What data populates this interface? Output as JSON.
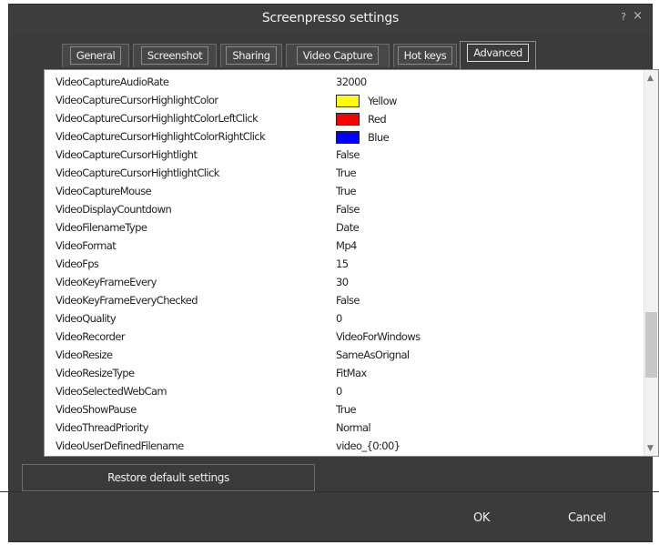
{
  "window": {
    "title": "Screenpresso settings",
    "help": "?",
    "close": "×"
  },
  "tabs": [
    {
      "label": "General"
    },
    {
      "label": "Screenshot"
    },
    {
      "label": "Sharing"
    },
    {
      "label": "Video Capture"
    },
    {
      "label": "Hot keys"
    },
    {
      "label": "Advanced",
      "active": true
    }
  ],
  "properties": [
    {
      "name": "VideoCaptureAudioRate",
      "value": "32000"
    },
    {
      "name": "VideoCaptureCursorHighlightColor",
      "value": "Yellow",
      "color": "#ffff00"
    },
    {
      "name": "VideoCaptureCursorHighlightColorLeftClick",
      "value": "Red",
      "color": "#ff0000"
    },
    {
      "name": "VideoCaptureCursorHighlightColorRightClick",
      "value": "Blue",
      "color": "#0000ff"
    },
    {
      "name": "VideoCaptureCursorHightlight",
      "value": "False"
    },
    {
      "name": "VideoCaptureCursorHightlightClick",
      "value": "True"
    },
    {
      "name": "VideoCaptureMouse",
      "value": "True"
    },
    {
      "name": "VideoDisplayCountdown",
      "value": "False"
    },
    {
      "name": "VideoFilenameType",
      "value": "Date"
    },
    {
      "name": "VideoFormat",
      "value": "Mp4"
    },
    {
      "name": "VideoFps",
      "value": "15"
    },
    {
      "name": "VideoKeyFrameEvery",
      "value": "30"
    },
    {
      "name": "VideoKeyFrameEveryChecked",
      "value": "False"
    },
    {
      "name": "VideoQuality",
      "value": "0"
    },
    {
      "name": "VideoRecorder",
      "value": "VideoForWindows"
    },
    {
      "name": "VideoResize",
      "value": "SameAsOrignal"
    },
    {
      "name": "VideoResizeType",
      "value": "FitMax"
    },
    {
      "name": "VideoSelectedWebCam",
      "value": "0"
    },
    {
      "name": "VideoShowPause",
      "value": "True"
    },
    {
      "name": "VideoThreadPriority",
      "value": "Normal"
    },
    {
      "name": "VideoUserDefinedFilename",
      "value": "video_{0:00}"
    }
  ],
  "buttons": {
    "restore": "Restore default settings",
    "ok": "OK",
    "cancel": "Cancel"
  },
  "scrollbar": {
    "up": "▲",
    "down": "▼"
  }
}
